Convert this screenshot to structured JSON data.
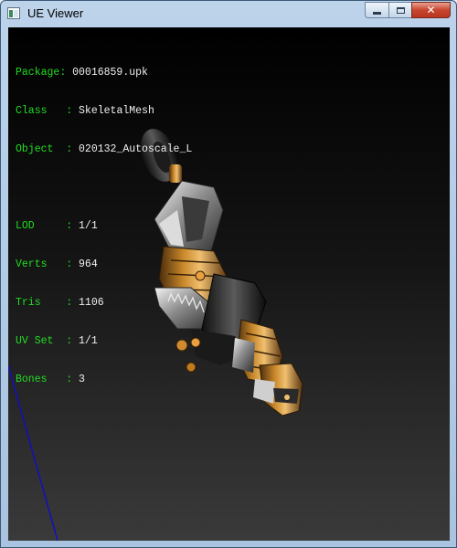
{
  "window": {
    "title": "UE Viewer",
    "icon": "app-icon"
  },
  "caption_buttons": {
    "minimize": "minimize-icon",
    "maximize": "maximize-icon",
    "close": "close-icon"
  },
  "info": {
    "package_label": "Package",
    "package_value": "00016859.upk",
    "class_label": "Class",
    "class_value": "SkeletalMesh",
    "object_label": "Object",
    "object_value": "020132_Autoscale_L",
    "lod_label": "LOD",
    "lod_value": "1/1",
    "verts_label": "Verts",
    "verts_value": "964",
    "tris_label": "Tris",
    "tris_value": "1106",
    "uvset_label": "UV Set",
    "uvset_value": "1/1",
    "bones_label": "Bones",
    "bones_value": "3"
  },
  "colors": {
    "label_green": "#22dd22",
    "value_white": "#f0f0f0",
    "axis_blue": "#1010c0",
    "close_red": "#c8452f"
  }
}
